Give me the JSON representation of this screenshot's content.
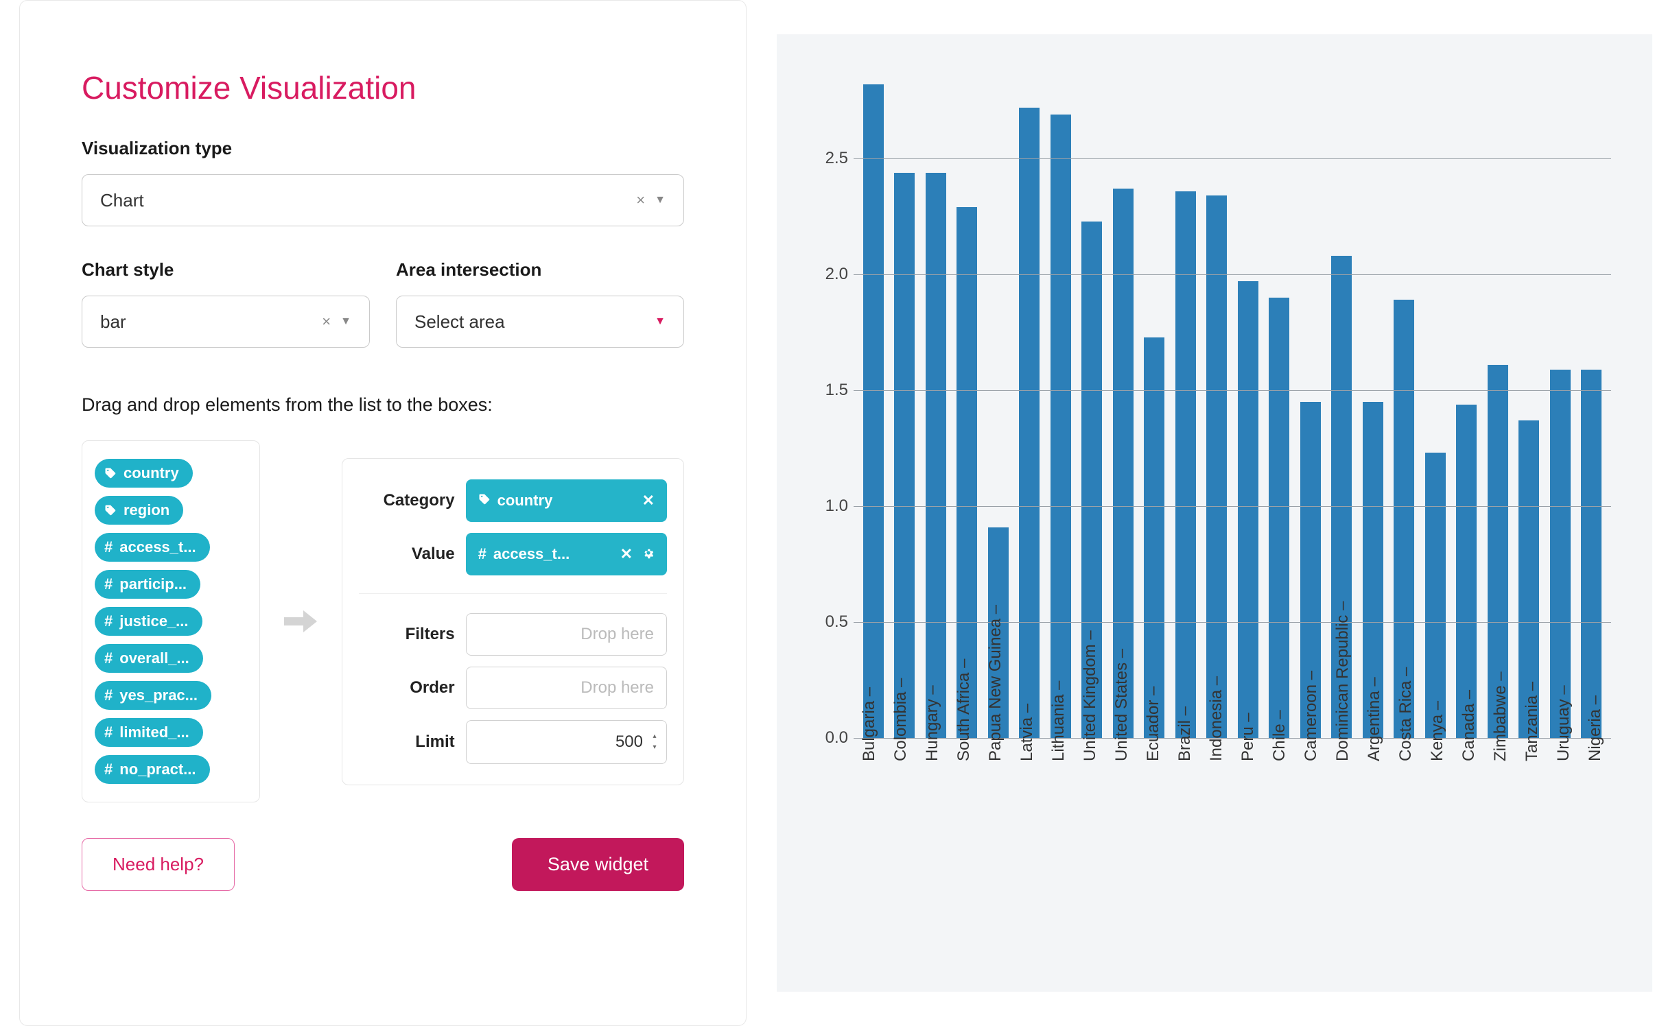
{
  "panel": {
    "title": "Customize Visualization",
    "viz_type_label": "Visualization type",
    "viz_type_value": "Chart",
    "chart_style_label": "Chart style",
    "chart_style_value": "bar",
    "area_label": "Area intersection",
    "area_placeholder": "Select area",
    "drag_instr": "Drag and drop elements from the list to the boxes:",
    "fields": [
      {
        "kind": "tag",
        "label": "country"
      },
      {
        "kind": "tag",
        "label": "region"
      },
      {
        "kind": "num",
        "label": "access_t..."
      },
      {
        "kind": "num",
        "label": "particip..."
      },
      {
        "kind": "num",
        "label": "justice_..."
      },
      {
        "kind": "num",
        "label": "overall_..."
      },
      {
        "kind": "num",
        "label": "yes_prac..."
      },
      {
        "kind": "num",
        "label": "limited_..."
      },
      {
        "kind": "num",
        "label": "no_pract..."
      }
    ],
    "drop": {
      "category_label": "Category",
      "category_value": "country",
      "value_label": "Value",
      "value_value": "access_t...",
      "filters_label": "Filters",
      "order_label": "Order",
      "limit_label": "Limit",
      "limit_value": "500",
      "drop_placeholder": "Drop here"
    },
    "help_btn": "Need help?",
    "save_btn": "Save widget"
  },
  "chart_data": {
    "type": "bar",
    "title": "",
    "xlabel": "",
    "ylabel": "",
    "ylim": [
      0.0,
      2.8
    ],
    "yticks": [
      0.0,
      0.5,
      1.0,
      1.5,
      2.0,
      2.5
    ],
    "categories": [
      "Bulgaria",
      "Colombia",
      "Hungary",
      "South Africa",
      "Papua New Guinea",
      "Latvia",
      "Lithuania",
      "United Kingdom",
      "United States",
      "Ecuador",
      "Brazil",
      "Indonesia",
      "Peru",
      "Chile",
      "Cameroon",
      "Dominican Republic",
      "Argentina",
      "Costa Rica",
      "Kenya",
      "Canada",
      "Zimbabwe",
      "Tanzania",
      "Uruguay",
      "Nigeria"
    ],
    "values": [
      2.82,
      2.44,
      2.44,
      2.29,
      0.91,
      2.72,
      2.69,
      2.23,
      2.37,
      1.73,
      2.36,
      2.34,
      1.97,
      1.9,
      1.45,
      2.08,
      1.45,
      1.89,
      1.23,
      1.44,
      1.61,
      1.37,
      1.59,
      1.59
    ]
  }
}
